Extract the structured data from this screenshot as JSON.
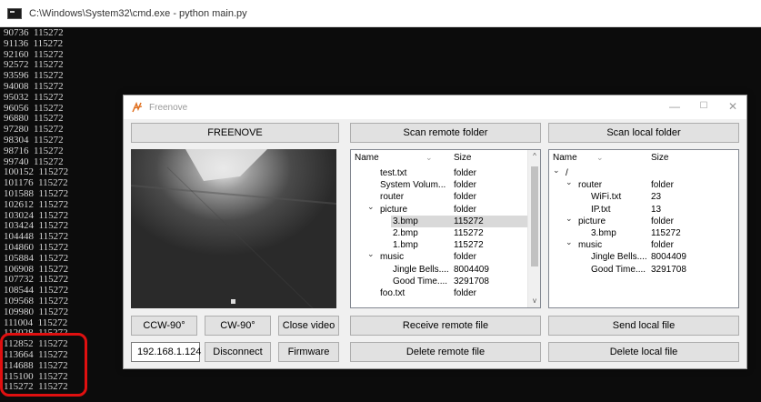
{
  "cmd": {
    "title": "C:\\Windows\\System32\\cmd.exe - python  main.py",
    "lines": [
      "90736  115272",
      "91136  115272",
      "92160  115272",
      "92572  115272",
      "93596  115272",
      "94008  115272",
      "95032  115272",
      "96056  115272",
      "96880  115272",
      "97280  115272",
      "98304  115272",
      "98716  115272",
      "99740  115272",
      "100152  115272",
      "101176  115272",
      "101588  115272",
      "102612  115272",
      "103024  115272",
      "103424  115272",
      "104448  115272",
      "104860  115272",
      "105884  115272",
      "106908  115272",
      "107732  115272",
      "108544  115272",
      "109568  115272",
      "109980  115272",
      "111004  115272",
      "112028  115272",
      "112852  115272",
      "113664  115272",
      "114688  115272",
      "115100  115272",
      "115272  115272"
    ]
  },
  "app": {
    "title": "Freenove",
    "window_controls": {
      "minimize": "—",
      "maximize": "☐",
      "close": "✕"
    },
    "buttons": {
      "freenove": "FREENOVE",
      "scan_remote": "Scan remote folder",
      "scan_local": "Scan local folder",
      "ccw": "CCW-90°",
      "cw": "CW-90°",
      "close_video": "Close video",
      "receive_remote": "Receive remote file",
      "send_local": "Send local file",
      "disconnect": "Disconnect",
      "firmware": "Firmware",
      "delete_remote": "Delete remote file",
      "delete_local": "Delete local file"
    },
    "ip": "192.168.1.124",
    "remote_tree": {
      "headers": {
        "name": "Name",
        "size": "Size"
      },
      "rows": [
        {
          "name": "test.txt",
          "size": "folder",
          "arrow": ""
        },
        {
          "name": "System Volum...",
          "size": "folder",
          "arrow": ""
        },
        {
          "name": "router",
          "size": "folder",
          "arrow": ""
        },
        {
          "name": "picture",
          "size": "folder",
          "arrow": "⌄"
        },
        {
          "name": "3.bmp",
          "size": "115272",
          "arrow": ""
        },
        {
          "name": "2.bmp",
          "size": "115272",
          "arrow": ""
        },
        {
          "name": "1.bmp",
          "size": "115272",
          "arrow": ""
        },
        {
          "name": "music",
          "size": "folder",
          "arrow": "⌄"
        },
        {
          "name": "Jingle Bells....",
          "size": "8004409",
          "arrow": ""
        },
        {
          "name": "Good Time....",
          "size": "3291708",
          "arrow": ""
        },
        {
          "name": "foo.txt",
          "size": "folder",
          "arrow": ""
        }
      ]
    },
    "local_tree": {
      "headers": {
        "name": "Name",
        "size": "Size"
      },
      "rows": [
        {
          "name": "/",
          "size": "",
          "arrow": "⌄"
        },
        {
          "name": "router",
          "size": "folder",
          "arrow": "⌄"
        },
        {
          "name": "WiFi.txt",
          "size": "23",
          "arrow": ""
        },
        {
          "name": "IP.txt",
          "size": "13",
          "arrow": ""
        },
        {
          "name": "picture",
          "size": "folder",
          "arrow": "⌄"
        },
        {
          "name": "3.bmp",
          "size": "115272",
          "arrow": ""
        },
        {
          "name": "music",
          "size": "folder",
          "arrow": "⌄"
        },
        {
          "name": "Jingle Bells....",
          "size": "8004409",
          "arrow": ""
        },
        {
          "name": "Good Time....",
          "size": "3291708",
          "arrow": ""
        }
      ]
    }
  },
  "colors": {
    "highlight": "#e01010",
    "console_bg": "#0c0c0c",
    "console_text": "#d8d8d8"
  }
}
